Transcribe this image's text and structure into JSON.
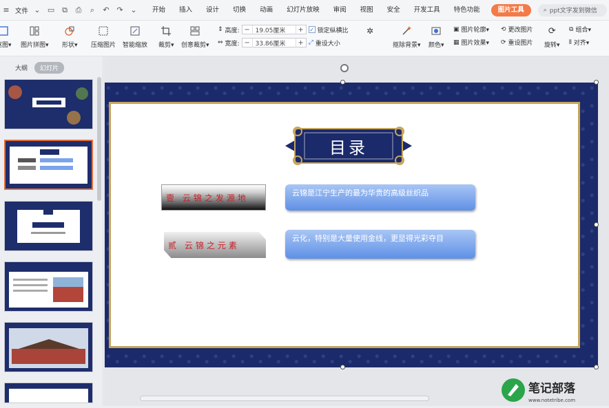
{
  "menubar": {
    "file_label": "文件",
    "tabs": [
      "开始",
      "插入",
      "设计",
      "切换",
      "动画",
      "幻灯片放映",
      "审阅",
      "视图",
      "安全",
      "开发工具",
      "特色功能"
    ],
    "active_tab": "图片工具",
    "search_placeholder": "ppt文字发到微信"
  },
  "ribbon": {
    "btn_matting": "抠图▾",
    "btn_collage": "图片拼图▾",
    "btn_shape": "形状▾",
    "btn_compress": "压缩图片",
    "btn_smartscale": "智能缩放",
    "btn_crop": "裁剪▾",
    "btn_creative_crop": "创意裁剪▾",
    "height_label": "高度:",
    "height_value": "19.05厘米",
    "width_label": "宽度:",
    "width_value": "33.86厘米",
    "lock_ratio_label": "锁定纵横比",
    "reset_size_label": "重设大小",
    "btn_remove_bg": "抠除背景▾",
    "btn_color": "颜色▾",
    "btn_outline": "图片轮廓▾",
    "btn_effect": "图片效果▾",
    "btn_change": "更改图片",
    "btn_reset": "重设图片",
    "btn_rotate": "旋转▾",
    "btn_group": "组合▾",
    "btn_align": "对齐▾"
  },
  "left_pane": {
    "tab_outline": "大纲",
    "tab_slides": "幻灯片",
    "selected_index": 2
  },
  "slide": {
    "title": "目录",
    "items": [
      {
        "label": "壹  云锦之发源地",
        "text": "云锦是江宁生产的最为华贵的高级丝织品"
      },
      {
        "label": "贰  云锦之元素",
        "text": "云化，特别是大量使用金线，更显得光彩夺目"
      }
    ],
    "colors": {
      "navy": "#1b2a6a",
      "gold": "#c6a45a",
      "red": "#c8202a",
      "accent": "#f47a48"
    }
  },
  "watermark": {
    "text": "笔记部落",
    "sub": "www.notetribe.com"
  }
}
